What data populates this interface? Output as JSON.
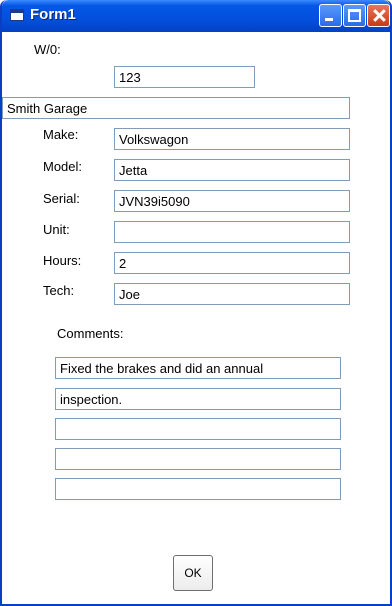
{
  "window": {
    "title": "Form1"
  },
  "labels": {
    "wo": "W/0:",
    "make": "Make:",
    "model": "Model:",
    "serial": "Serial:",
    "unit": "Unit:",
    "hours": "Hours:",
    "tech": "Tech:",
    "comments": "Comments:"
  },
  "fields": {
    "wo": "123",
    "customer": "Smith Garage",
    "make": "Volkswagon",
    "model": "Jetta",
    "serial": "JVN39i5090",
    "unit": "",
    "hours": "2",
    "tech": "Joe"
  },
  "comments": [
    "Fixed the brakes and did an annual",
    "inspection.",
    "",
    "",
    ""
  ],
  "ok_label": "OK"
}
